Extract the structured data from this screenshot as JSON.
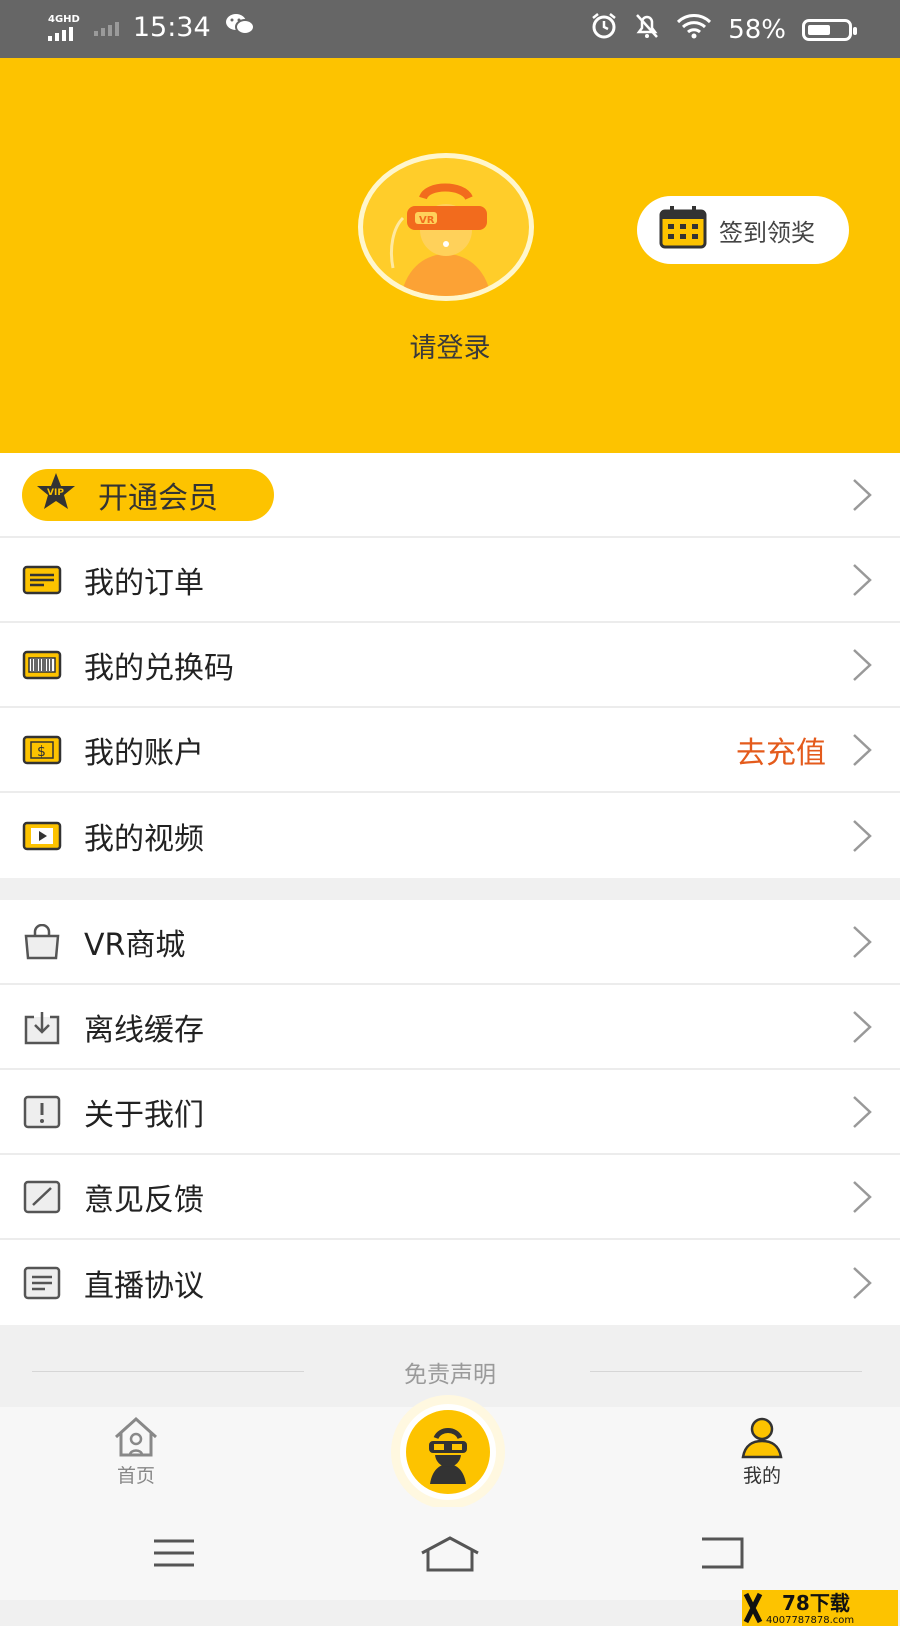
{
  "status_bar": {
    "network": "4GHD",
    "time": "15:34",
    "battery_percent": "58%",
    "battery_level": 0.58
  },
  "header": {
    "login_text": "请登录",
    "checkin_label": "签到领奖",
    "background": "#fdc300"
  },
  "vip": {
    "label": "开通会员",
    "badge": "VIP"
  },
  "account_section": [
    {
      "label": "我的订单",
      "icon": "order-icon"
    },
    {
      "label": "我的兑换码",
      "icon": "barcode-icon"
    },
    {
      "label": "我的账户",
      "icon": "dollar-card-icon",
      "extra": "去充值"
    },
    {
      "label": "我的视频",
      "icon": "video-icon"
    }
  ],
  "general_section": [
    {
      "label": "VR商城",
      "icon": "shopping-bag-icon"
    },
    {
      "label": "离线缓存",
      "icon": "download-icon"
    },
    {
      "label": "关于我们",
      "icon": "info-icon"
    },
    {
      "label": "意见反馈",
      "icon": "feedback-icon"
    },
    {
      "label": "直播协议",
      "icon": "document-icon"
    }
  ],
  "disclaimer": "免责声明",
  "tabs": {
    "home": "首页",
    "mine": "我的"
  },
  "watermark": {
    "brand": "78下载",
    "phone": "4007787878.com"
  },
  "colors": {
    "accent": "#fdc300",
    "recharge": "#e45b1c"
  }
}
